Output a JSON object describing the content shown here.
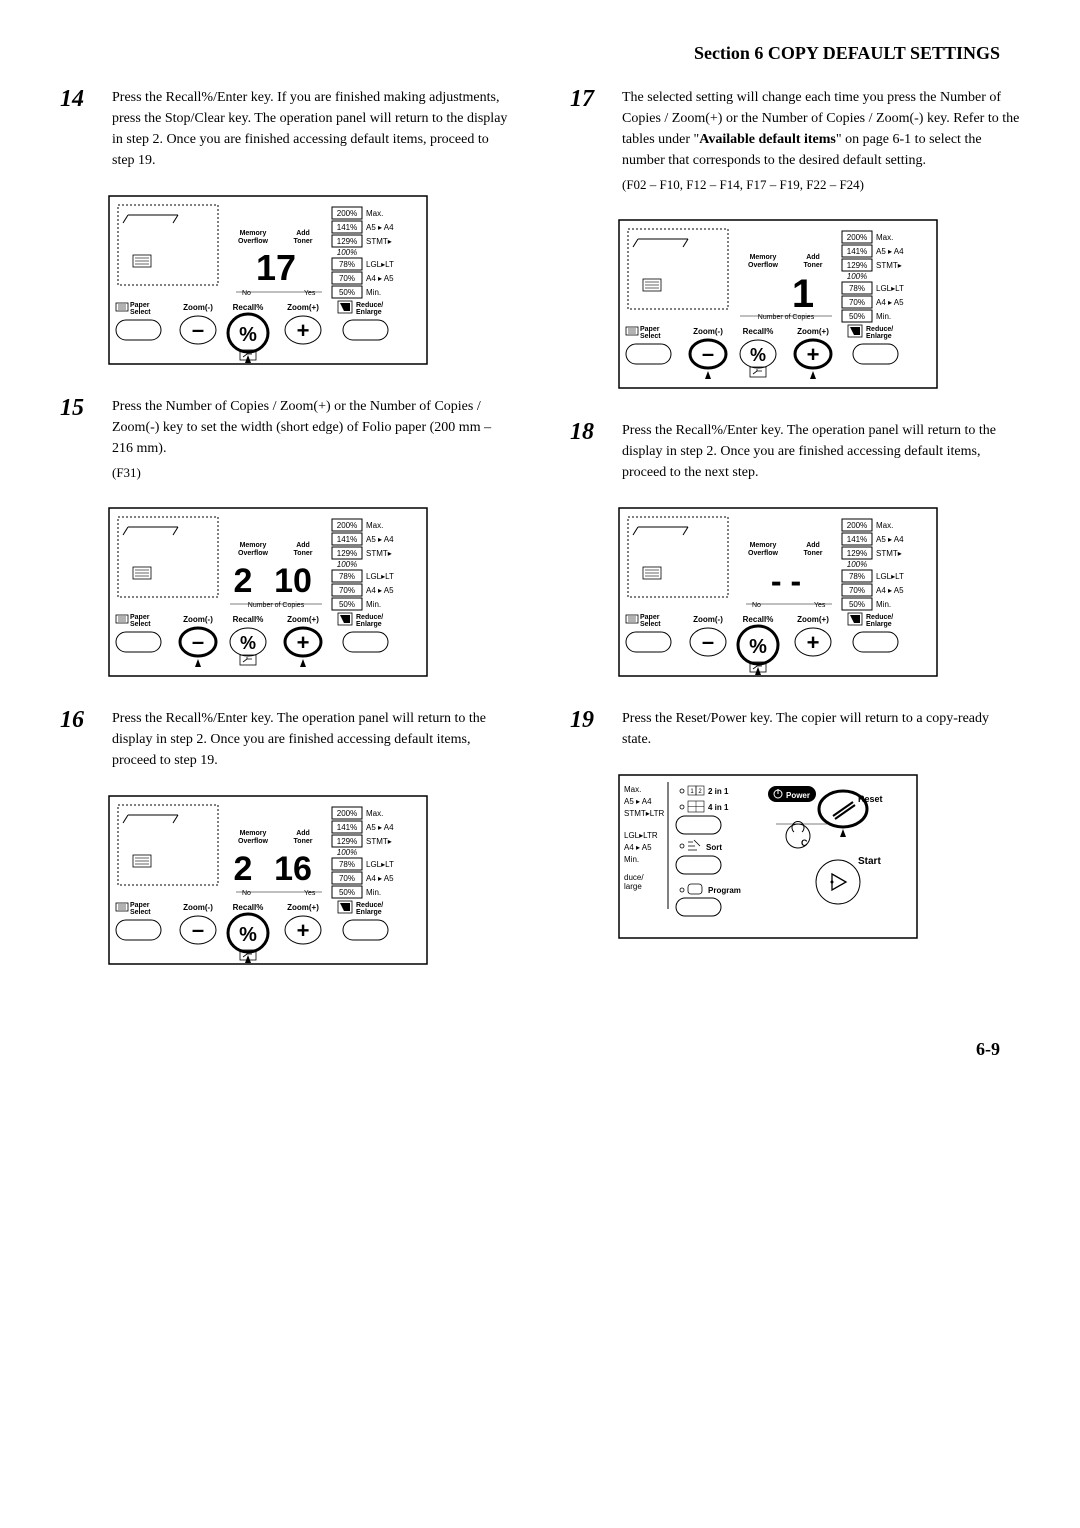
{
  "header": "Section 6  COPY DEFAULT SETTINGS",
  "page_number": "6-9",
  "steps": {
    "s14": {
      "num": "14",
      "text": "Press the Recall%/Enter key. If you are finished making adjustments, press the Stop/Clear key. The operation panel will return to the display in step 2. Once you are finished accessing default items, proceed to step 19."
    },
    "s15": {
      "num": "15",
      "text": "Press the Number of Copies / Zoom(+) or the Number of Copies / Zoom(-) key to set the width (short edge) of Folio paper (200 mm – 216 mm).",
      "code": "(F31)"
    },
    "s16": {
      "num": "16",
      "text": "Press the Recall%/Enter key. The operation panel will return to the display in step 2. Once you are finished accessing default items, proceed to step 19."
    },
    "s17": {
      "num": "17",
      "text_before": "The selected setting will change each time you press the Number of Copies / Zoom(+) or the Number of Copies / Zoom(-) key. Refer to the tables under \"",
      "bold": "Available default items",
      "text_after": "\" on page 6-1 to select the number that corresponds to the desired default setting.",
      "code": "(F02 – F10, F12 – F14, F17 – F19, F22 – F24)"
    },
    "s18": {
      "num": "18",
      "text": "Press the Recall%/Enter key. The operation panel will return to the display in step 2. Once you are finished accessing default items, proceed to the next step."
    },
    "s19": {
      "num": "19",
      "text": "Press the Reset/Power key. The copier will return to a copy-ready state."
    }
  },
  "panel": {
    "memory_overflow": "Memory\nOverflow",
    "add_toner": "Add\nToner",
    "paper_select": "Paper\nSelect",
    "zoom_minus": "Zoom(-)",
    "zoom_plus": "Zoom(+)",
    "recall": "Recall%",
    "reduce_enlarge": "Reduce/\nEnlarge",
    "number_copies": "Number of Copies",
    "max": "Max.",
    "a5a4": "A5 ▸ A4",
    "stmt": "STMT▸",
    "pct100": "100%",
    "lgl": "LGL▸LT",
    "a4a5": "A4 ▸ A5",
    "min": "Min.",
    "pct200": "200%",
    "pct141": "141%",
    "pct129": "129%",
    "pct78": "78%",
    "pct70": "70%",
    "pct50": "50%",
    "yes": "Yes",
    "no": "No",
    "disp14": "17",
    "disp15_1": "2",
    "disp15_2": "10",
    "disp16_1": "2",
    "disp16_2": "16",
    "disp17": "1",
    "disp18": "- -"
  },
  "panel19": {
    "max": "Max.",
    "a5a4": "A5 ▸ A4",
    "stmtltr": "STMT▸LTR",
    "lglltr": "LGL▸LTR",
    "a4a5": "A4 ▸ A5",
    "min": "Min.",
    "duce": "duce/\nlarge",
    "two_in_1": "2 in 1",
    "four_in_1": "4 in 1",
    "sort": "Sort",
    "program": "Program",
    "power": "Power",
    "reset": "Reset",
    "start": "Start"
  }
}
